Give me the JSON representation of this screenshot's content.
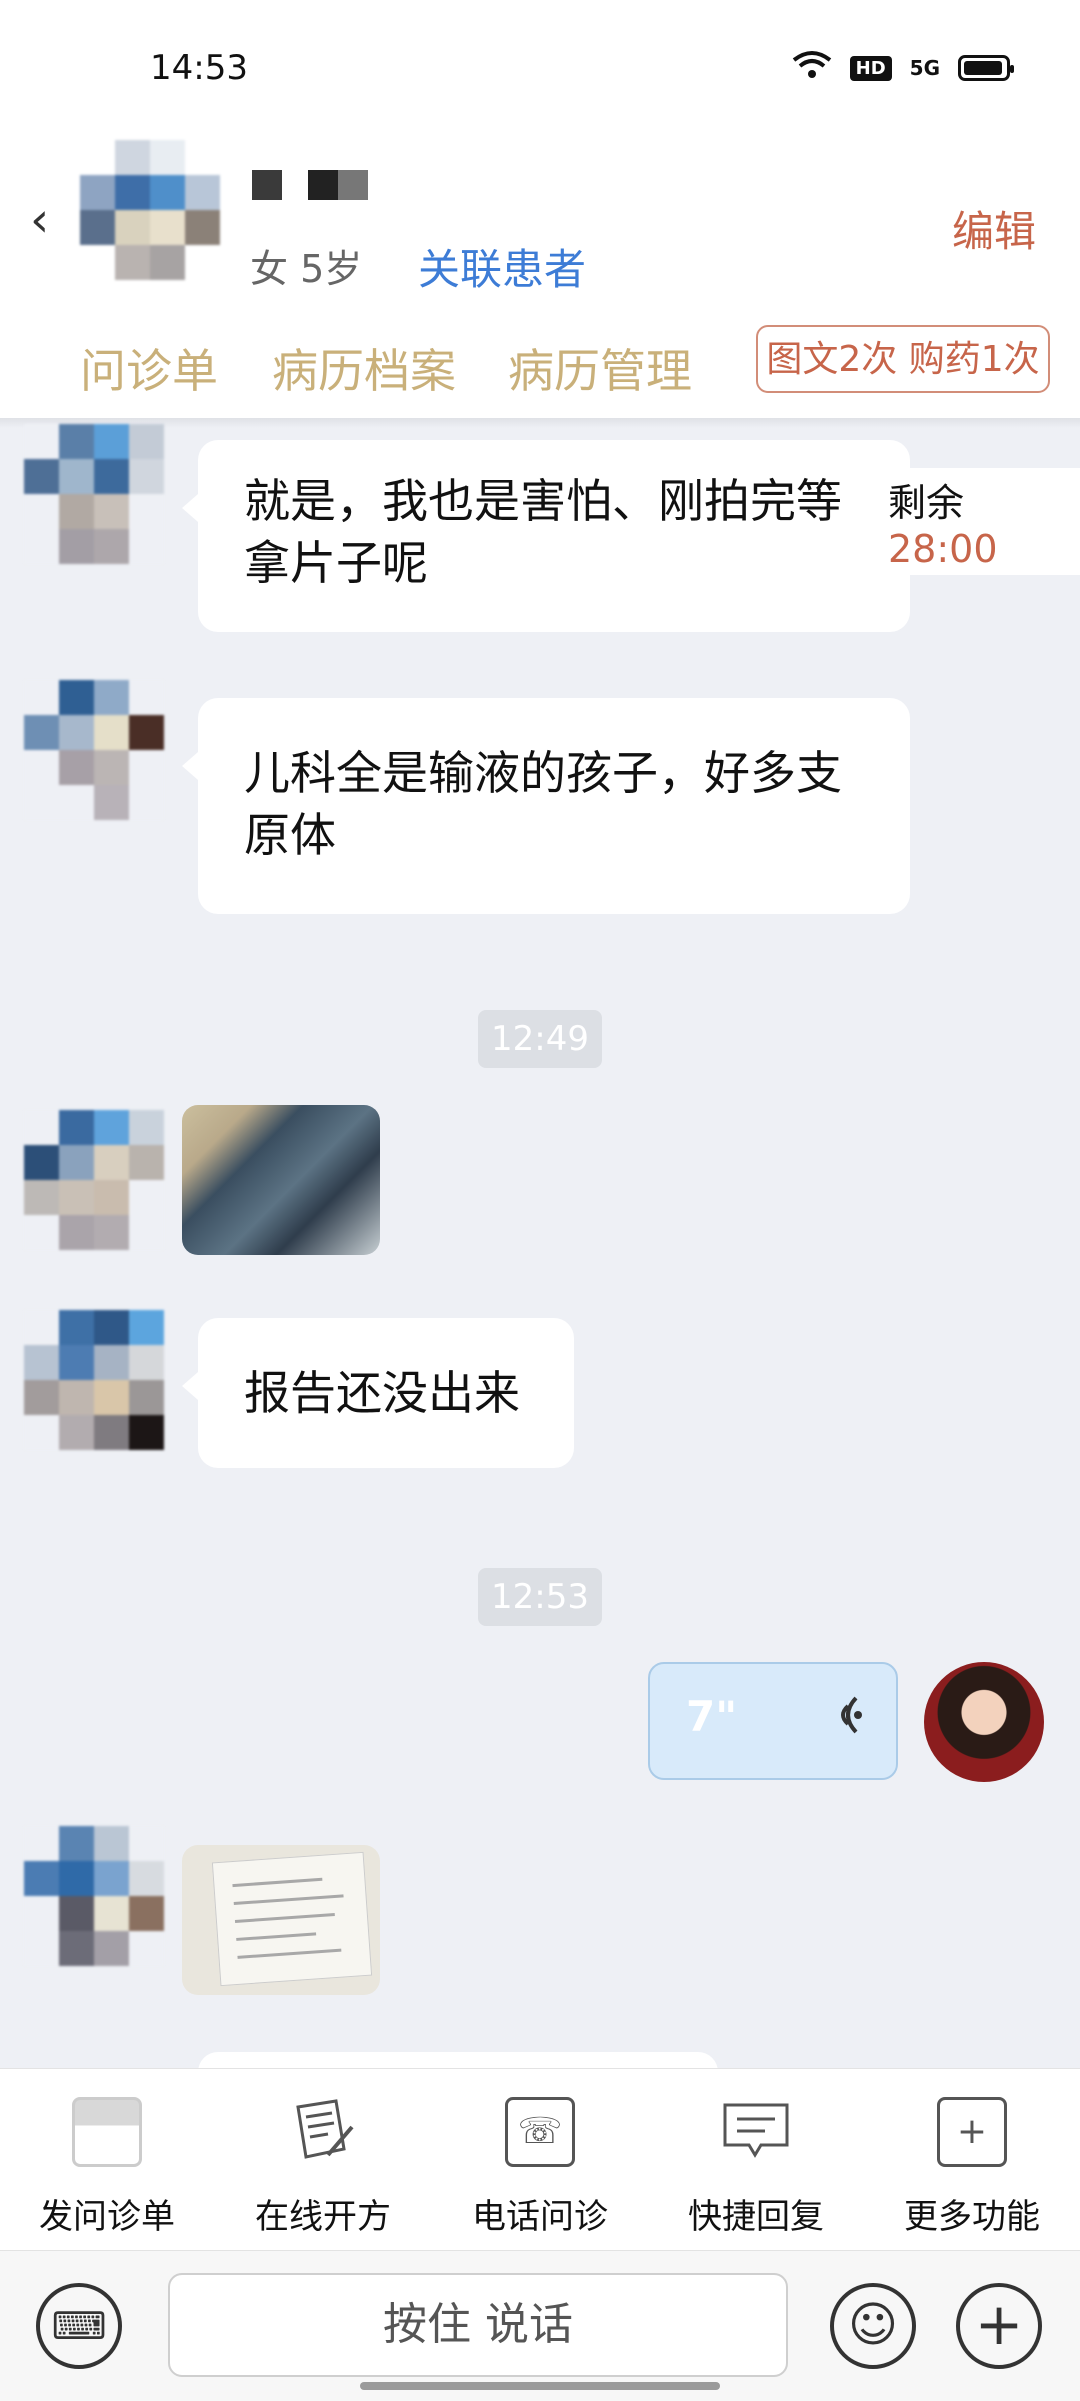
{
  "status_bar": {
    "time": "14:53",
    "network": "5G",
    "hd": "HD"
  },
  "header": {
    "patient_info": "女 5岁",
    "link_patient": "关联患者",
    "edit": "编辑",
    "tabs": [
      {
        "label": "问诊单"
      },
      {
        "label": "病历档案"
      },
      {
        "label": "病历管理"
      }
    ],
    "record_badge": "图文2次 购药1次"
  },
  "countdown": {
    "label": "剩余",
    "time": "28:00"
  },
  "messages": [
    {
      "type": "text",
      "from": "patient",
      "text": "就是，我也是害怕、刚拍完等拿片子呢"
    },
    {
      "type": "text",
      "from": "patient",
      "text": "儿科全是输液的孩子，好多支原体"
    },
    {
      "type": "time",
      "text": "12:49"
    },
    {
      "type": "image",
      "from": "patient"
    },
    {
      "type": "text",
      "from": "patient",
      "text": "报告还没出来"
    },
    {
      "type": "time",
      "text": "12:53"
    },
    {
      "type": "voice",
      "from": "doctor",
      "duration": "7\""
    },
    {
      "type": "image",
      "from": "patient"
    }
  ],
  "toolbar": {
    "items": [
      {
        "label": "发问诊单",
        "icon": "form-icon"
      },
      {
        "label": "在线开方",
        "icon": "prescription-icon"
      },
      {
        "label": "电话问诊",
        "icon": "phone-icon"
      },
      {
        "label": "快捷回复",
        "icon": "quick-reply-icon"
      },
      {
        "label": "更多功能",
        "icon": "more-icon"
      }
    ]
  },
  "input": {
    "hold_to_talk": "按住 说话"
  }
}
